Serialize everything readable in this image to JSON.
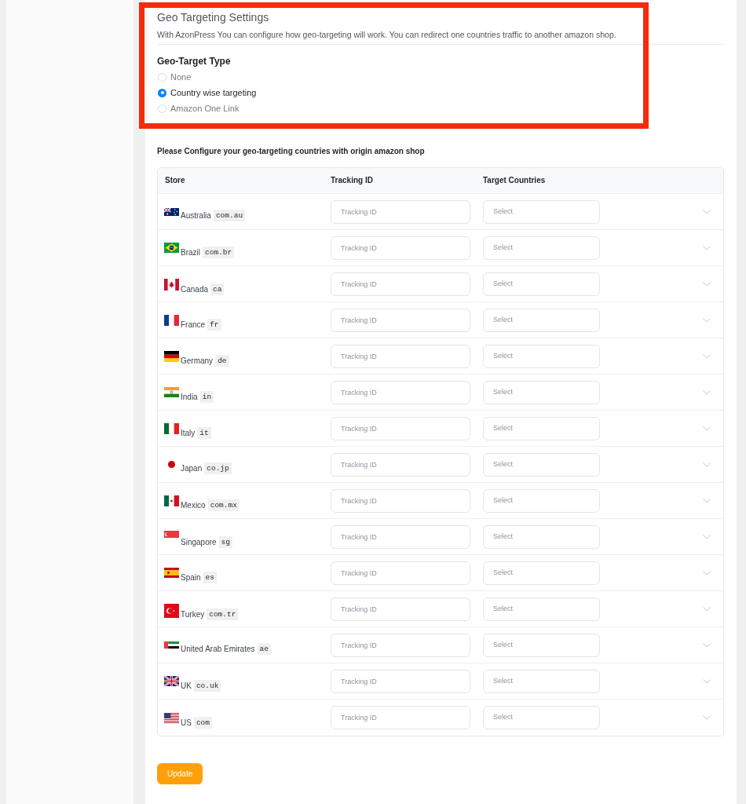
{
  "settings": {
    "title": "Geo Targeting Settings",
    "description": "With AzonPress You can configure how geo-targeting will work. You can redirect one countries traffic to another amazon shop."
  },
  "geo_target_type": {
    "label": "Geo-Target Type",
    "options": [
      {
        "label": "None",
        "selected": false
      },
      {
        "label": "Country wise targeting",
        "selected": true
      },
      {
        "label": "Amazon One Link",
        "selected": false
      }
    ]
  },
  "countries_table": {
    "intro": "Please Configure your geo-targeting countries with origin amazon shop",
    "columns": [
      "Store",
      "Tracking ID",
      "Target Countries"
    ],
    "rows": [
      {
        "store": "Australia",
        "domain": "com.au",
        "tracking_id": {
          "placeholder": "Tracking ID"
        },
        "target_countries": {
          "placeholder": "Select"
        }
      },
      {
        "store": "Brazil",
        "domain": "com.br",
        "tracking_id": {
          "placeholder": "Tracking ID"
        },
        "target_countries": {
          "placeholder": "Select"
        }
      },
      {
        "store": "Canada",
        "domain": "ca",
        "tracking_id": {
          "placeholder": "Tracking ID"
        },
        "target_countries": {
          "placeholder": "Select"
        }
      },
      {
        "store": "France",
        "domain": "fr",
        "tracking_id": {
          "placeholder": "Tracking ID"
        },
        "target_countries": {
          "placeholder": "Select"
        }
      },
      {
        "store": "Germany",
        "domain": "de",
        "tracking_id": {
          "placeholder": "Tracking ID"
        },
        "target_countries": {
          "placeholder": "Select"
        }
      },
      {
        "store": "India",
        "domain": "in",
        "tracking_id": {
          "placeholder": "Tracking ID"
        },
        "target_countries": {
          "placeholder": "Select"
        }
      },
      {
        "store": "Italy",
        "domain": "it",
        "tracking_id": {
          "placeholder": "Tracking ID"
        },
        "target_countries": {
          "placeholder": "Select"
        }
      },
      {
        "store": "Japan",
        "domain": "co.jp",
        "tracking_id": {
          "placeholder": "Tracking ID"
        },
        "target_countries": {
          "placeholder": "Select"
        }
      },
      {
        "store": "Mexico",
        "domain": "com.mx",
        "tracking_id": {
          "placeholder": "Tracking ID"
        },
        "target_countries": {
          "placeholder": "Select"
        }
      },
      {
        "store": "Singapore",
        "domain": "sg",
        "tracking_id": {
          "placeholder": "Tracking ID"
        },
        "target_countries": {
          "placeholder": "Select"
        }
      },
      {
        "store": "Spain",
        "domain": "es",
        "tracking_id": {
          "placeholder": "Tracking ID"
        },
        "target_countries": {
          "placeholder": "Select"
        }
      },
      {
        "store": "Turkey",
        "domain": "com.tr",
        "tracking_id": {
          "placeholder": "Tracking ID"
        },
        "target_countries": {
          "placeholder": "Select"
        }
      },
      {
        "store": "United Arab Emirates",
        "domain": "ae",
        "tracking_id": {
          "placeholder": "Tracking ID"
        },
        "target_countries": {
          "placeholder": "Select"
        }
      },
      {
        "store": "UK",
        "domain": "co.uk",
        "tracking_id": {
          "placeholder": "Tracking ID"
        },
        "target_countries": {
          "placeholder": "Select"
        }
      },
      {
        "store": "US",
        "domain": "com",
        "tracking_id": {
          "placeholder": "Tracking ID"
        },
        "target_countries": {
          "placeholder": "Select"
        }
      }
    ]
  },
  "update_button": {
    "label": "Update"
  }
}
